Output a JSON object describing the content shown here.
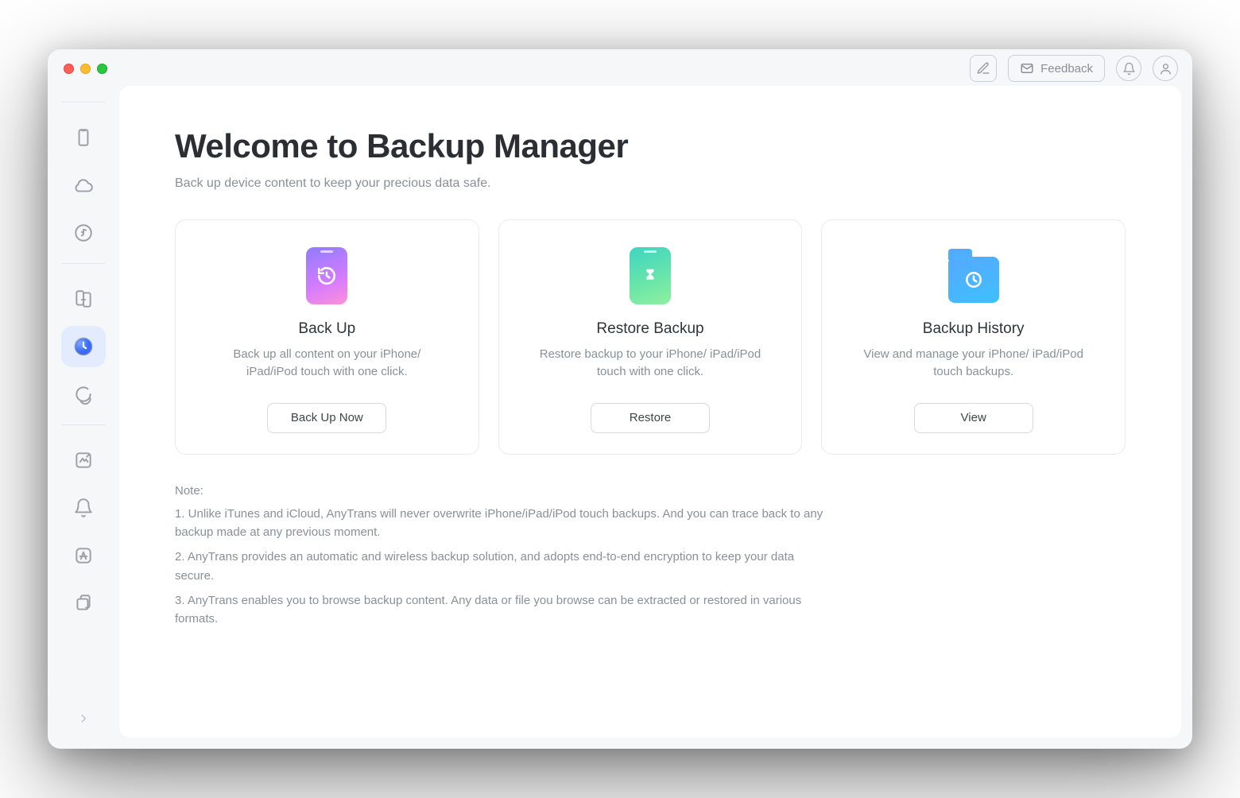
{
  "header": {
    "feedback_label": "Feedback"
  },
  "sidebar": {
    "items": [
      {
        "name": "device"
      },
      {
        "name": "icloud"
      },
      {
        "name": "media"
      },
      {
        "name": "phone-switcher"
      },
      {
        "name": "backup-manager"
      },
      {
        "name": "social-messages"
      },
      {
        "name": "screen-mirroring"
      },
      {
        "name": "ringtone"
      },
      {
        "name": "app-downloader"
      },
      {
        "name": "more"
      }
    ]
  },
  "main": {
    "title": "Welcome to Backup Manager",
    "subtitle": "Back up device content to keep your precious data safe.",
    "cards": [
      {
        "title": "Back Up",
        "desc": "Back up all content on your iPhone/ iPad/iPod touch with one click.",
        "button": "Back Up Now"
      },
      {
        "title": "Restore Backup",
        "desc": "Restore backup to your iPhone/ iPad/iPod touch with one click.",
        "button": "Restore"
      },
      {
        "title": "Backup History",
        "desc": "View and manage your iPhone/ iPad/iPod touch backups.",
        "button": "View"
      }
    ],
    "notes": {
      "heading": "Note:",
      "lines": [
        "1. Unlike iTunes and iCloud, AnyTrans will never overwrite iPhone/iPad/iPod touch backups. And you can trace back to any backup made at any previous moment.",
        "2. AnyTrans provides an automatic and wireless backup solution, and adopts end-to-end encryption to keep your data secure.",
        "3. AnyTrans enables you to browse backup content. Any data or file you browse can be extracted or restored in various formats."
      ]
    }
  }
}
